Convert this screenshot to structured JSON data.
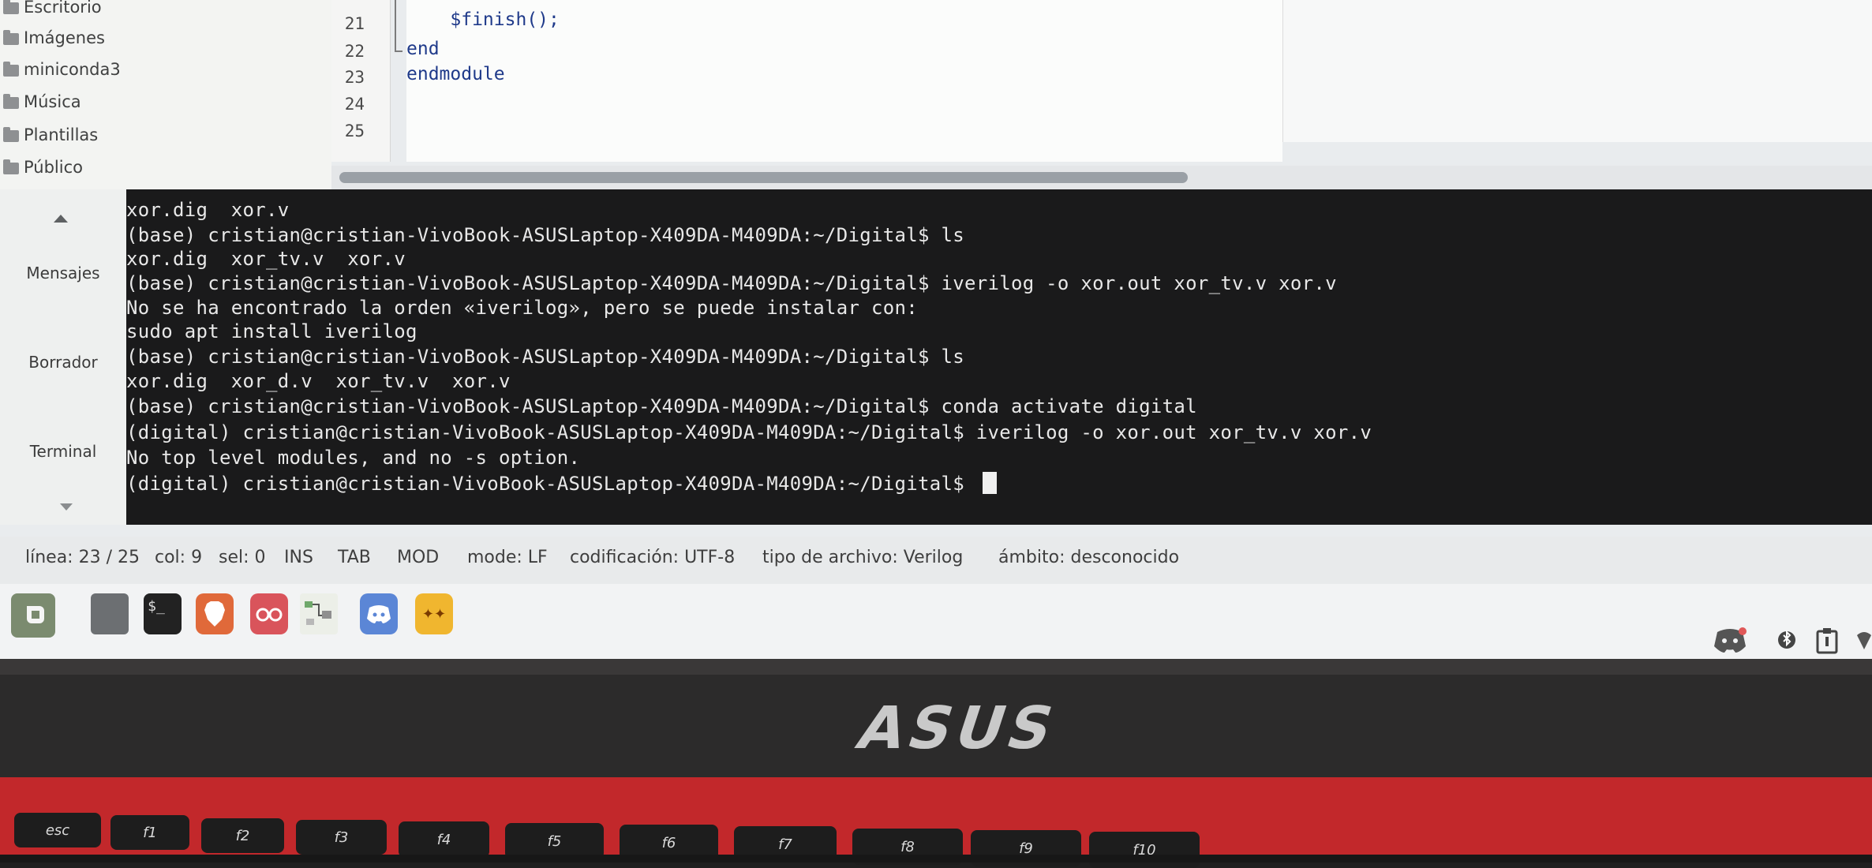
{
  "file_browser": {
    "items": [
      {
        "label": "Escritorio",
        "icon": "folder-icon"
      },
      {
        "label": "Imágenes",
        "icon": "folder-icon"
      },
      {
        "label": "miniconda3",
        "icon": "folder-icon"
      },
      {
        "label": "Música",
        "icon": "folder-icon"
      },
      {
        "label": "Plantillas",
        "icon": "folder-icon"
      },
      {
        "label": "Público",
        "icon": "folder-icon"
      }
    ]
  },
  "editor": {
    "line_numbers": [
      "21",
      "22",
      "23",
      "24",
      "25"
    ],
    "lines": [
      "    $finish();",
      "end",
      "endmodule",
      "",
      ""
    ]
  },
  "message_panel": {
    "tabs": [
      "Mensajes",
      "Borrador",
      "Terminal"
    ]
  },
  "terminal": {
    "lines": [
      "xor.dig  xor.v",
      "(base) cristian@cristian-VivoBook-ASUSLaptop-X409DA-M409DA:~/Digital$ ls",
      "xor.dig  xor_tv.v  xor.v",
      "(base) cristian@cristian-VivoBook-ASUSLaptop-X409DA-M409DA:~/Digital$ iverilog -o xor.out xor_tv.v xor.v",
      "No se ha encontrado la orden «iverilog», pero se puede instalar con:",
      "sudo apt install iverilog",
      "(base) cristian@cristian-VivoBook-ASUSLaptop-X409DA-M409DA:~/Digital$ ls",
      "xor.dig  xor_d.v  xor_tv.v  xor.v",
      "(base) cristian@cristian-VivoBook-ASUSLaptop-X409DA-M409DA:~/Digital$ conda activate digital",
      "(digital) cristian@cristian-VivoBook-ASUSLaptop-X409DA-M409DA:~/Digital$ iverilog -o xor.out xor_tv.v xor.v",
      "No top level modules, and no -s option.",
      "(digital) cristian@cristian-VivoBook-ASUSLaptop-X409DA-M409DA:~/Digital$ "
    ]
  },
  "statusbar": {
    "line": "línea: 23 / 25",
    "col": "col: 9",
    "sel": "sel: 0",
    "ins": "INS",
    "tab": "TAB",
    "mod": "MOD",
    "mode": "mode: LF",
    "encoding": "codificación: UTF-8",
    "filetype": "tipo de archivo: Verilog",
    "scope": "ámbito: desconocido"
  },
  "taskbar": {
    "icons": [
      "mint-menu-icon",
      "files-icon",
      "terminal-icon",
      "brave-icon",
      "glasses-icon",
      "digital-circuit-icon",
      "discord-icon",
      "stars-app-icon"
    ],
    "tray_icons": [
      "discord-tray-icon",
      "bluetooth-icon",
      "clipboard-icon",
      "network-icon"
    ]
  },
  "hardware": {
    "brand": "ASUS",
    "keys": [
      "esc",
      "f1",
      "f2",
      "f3",
      "f4",
      "f5",
      "f6",
      "f7",
      "f8",
      "f9",
      "f10"
    ]
  },
  "colors": {
    "terminal_bg": "#1a1a1b",
    "terminal_fg": "#e8e8e8",
    "keyboard_red": "#c2282b",
    "code_blue": "#1f3a8a"
  }
}
